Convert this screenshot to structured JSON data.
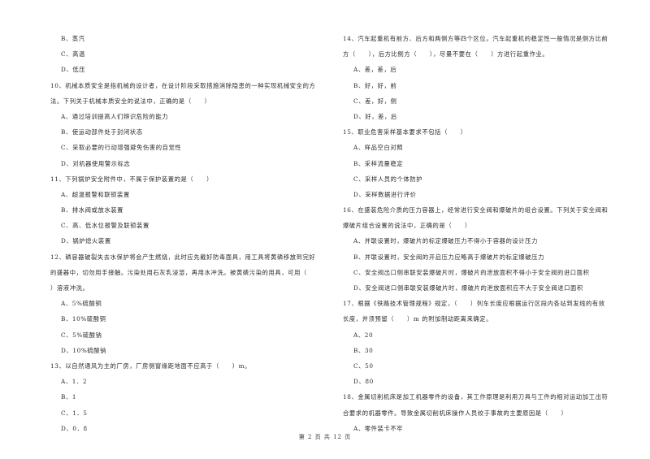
{
  "left_column": [
    {
      "type": "opt",
      "text": "B、蒸汽"
    },
    {
      "type": "opt",
      "text": "C、高温"
    },
    {
      "type": "opt",
      "text": "D、低压"
    },
    {
      "type": "q",
      "text": "10、机械本质安全是指机械的设计者，在设计阶段采取措施消除隐患的一种实现机械安全的方"
    },
    {
      "type": "cont",
      "text": "法。下列关于机械本质安全的说法中，正确的是（　　）"
    },
    {
      "type": "opt",
      "text": "A、通过培训提高人们辨识危险的能力"
    },
    {
      "type": "opt",
      "text": "B、使运动部件处于封闭状态"
    },
    {
      "type": "opt",
      "text": "C、采取必要的行动增强避免伤害的自觉性"
    },
    {
      "type": "opt",
      "text": "D、对机器使用警示标志"
    },
    {
      "type": "q",
      "text": "11、下列锅炉安全附件中，不属于保护装置的是（　　）"
    },
    {
      "type": "opt",
      "text": "A、超温报警和联锁装置"
    },
    {
      "type": "opt",
      "text": "B、排水阀或放水装置"
    },
    {
      "type": "opt",
      "text": "C、高、低水位报警及联锁装置"
    },
    {
      "type": "opt",
      "text": "D、锅炉熄火装置"
    },
    {
      "type": "q",
      "text": "12、磷容器破裂失去水保护将会产生燃烧，此时应先戴好防毒面具，用工具将黄磷移放到完好"
    },
    {
      "type": "cont",
      "text": "的盛器中，切勿用手接触。污染处用石灰乳浸湿，再用水冲洗。被黄磷污染的用具，可用（"
    },
    {
      "type": "cont",
      "text": "）溶液冲洗。"
    },
    {
      "type": "opt",
      "text": "A、5%硫酸铜"
    },
    {
      "type": "opt",
      "text": "B、10%硫酸铜"
    },
    {
      "type": "opt",
      "text": "C、5%硫酸钠"
    },
    {
      "type": "opt",
      "text": "D、10%硫酸钠"
    },
    {
      "type": "q",
      "text": "13、以自然通风为主的厂房，厂房侧窗缘距地面不应高于（　　）m。"
    },
    {
      "type": "opt",
      "text": "A、1．2"
    },
    {
      "type": "opt",
      "text": "B、1"
    },
    {
      "type": "opt",
      "text": "C、1．5"
    },
    {
      "type": "opt",
      "text": "D、0．8"
    }
  ],
  "right_column": [
    {
      "type": "q",
      "text": "14、汽车起重机有前方、后方和两侧方等四个区位。汽车起重机的稳定性一般情况是侧方比前"
    },
    {
      "type": "cont",
      "text": "方（　　），后方比侧方（　　），尽量不要在（　　）方进行起重作业。"
    },
    {
      "type": "opt",
      "text": "A、差，差，后"
    },
    {
      "type": "opt",
      "text": "B、好，好，前"
    },
    {
      "type": "opt",
      "text": "C、差，好，侧"
    },
    {
      "type": "opt",
      "text": "D、好，差，后"
    },
    {
      "type": "q",
      "text": "15、职业危害采样基本要求不包括（　　）"
    },
    {
      "type": "opt",
      "text": "A、样品空白对照"
    },
    {
      "type": "opt",
      "text": "B、采样流量稳定"
    },
    {
      "type": "opt",
      "text": "C、采样人员的个体防护"
    },
    {
      "type": "opt",
      "text": "D、采样数据进行评价"
    },
    {
      "type": "q",
      "text": "16、在盛装危险介质的压力容器上，经常进行安全阀和爆破片的组合设置。下列关于安全阀和"
    },
    {
      "type": "cont",
      "text": "爆破片组合设置的说法中，正确的是（　　）"
    },
    {
      "type": "opt",
      "text": "A、并联设置时，爆破片的标定爆破压力不得小于容器的设计压力"
    },
    {
      "type": "opt",
      "text": "B、并联设置时，安全阀的开启压力应略高于爆破片的标定爆破压力"
    },
    {
      "type": "opt",
      "text": "C、安全阀出口侧串联安装爆破片时，爆破片的泄放面积不得小于安全阀的进口面积"
    },
    {
      "type": "opt",
      "text": "D、安全阀进口侧串联安装爆破片时，爆破片的泄放面积应不大于安全阀进口面积"
    },
    {
      "type": "q",
      "text": "17、根据《铁路技术管理规程》规定，（　　）列车长度应根据运行区段内各站到发线的有效"
    },
    {
      "type": "cont",
      "text": "长度，并须预留（　　）m 的附加制动距离来确定。"
    },
    {
      "type": "opt",
      "text": "A、20"
    },
    {
      "type": "opt",
      "text": "B、30"
    },
    {
      "type": "opt",
      "text": "C、50"
    },
    {
      "type": "opt",
      "text": "D、80"
    },
    {
      "type": "q",
      "text": "18、金属切削机床是加工机器零件的设备，其工作原理是利用刀具与工件的相对运动加工出符"
    },
    {
      "type": "cont",
      "text": "合要求的机器零件。导致金属切削机床操作人员绞于事故的主要原因是（　　）"
    },
    {
      "type": "opt",
      "text": "A、零件装卡不牢"
    }
  ],
  "footer": {
    "page_label": "第 2 页 共 12 页"
  }
}
